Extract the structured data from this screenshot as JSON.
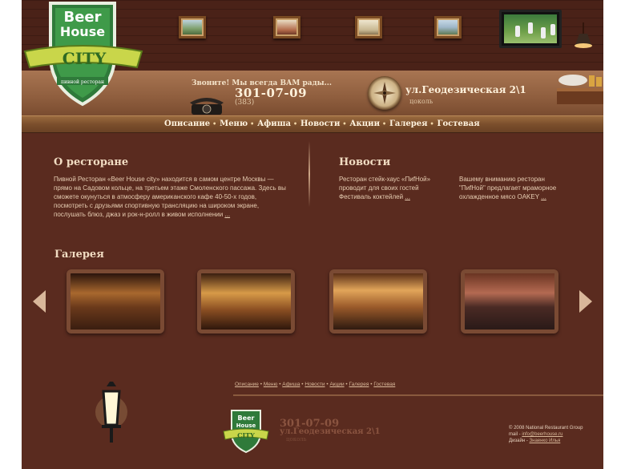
{
  "header": {
    "logo": {
      "line1": "Beer",
      "line2": "House",
      "ribbon": "CITY",
      "caption": "пивной ресторан"
    },
    "call_text": "Звоните! Мы всегда ВАМ рады...",
    "phone": "301-07-09",
    "phone_code": "(383)",
    "address": "ул.Геодезическая 2\\1",
    "level": "цоколь"
  },
  "nav": {
    "items": [
      "Описание",
      "Меню",
      "Афиша",
      "Новости",
      "Акции",
      "Галерея",
      "Гостевая"
    ]
  },
  "about": {
    "title": "О ресторане",
    "text": "Пивной Ресторан «Beer House city» находится в самом центре Москвы — прямо на Садовом кольце, на третьем этаже Смоленского пассажа. Здесь вы сможете окунуться в атмосферу американского кафе 40-50-х годов, посмотреть с друзьями спортивную трансляцию на широком экране, послушать блюз, джаз и рок-н-ролл в живом исполнении",
    "more": "..."
  },
  "news": {
    "title": "Новости",
    "items": [
      {
        "text": "Ресторан стейк-хаус «ПиfНой» проводит для своих гостей Фестиваль коктейлей",
        "more": "..."
      },
      {
        "text": "Вашему вниманию ресторан \"ПиfНой\" предлагает мраморное охлажденное мясо OAKEY",
        "more": "..."
      }
    ]
  },
  "gallery": {
    "title": "Галерея",
    "photos": [
      "gallery-photo-1",
      "gallery-photo-2",
      "gallery-photo-3",
      "gallery-photo-4"
    ]
  },
  "footer": {
    "links": [
      "Описание",
      "Меню",
      "Афиша",
      "Новости",
      "Акции",
      "Галерея",
      "Гостевая"
    ],
    "phone": "301-07-09",
    "address": "ул.Геодезическая 2\\1",
    "level": "цоколь",
    "copyright": "© 2008 National Restaurant Group",
    "mail_label": "mail - ",
    "mail": "info@beerhouse.ru",
    "design_label": "Дизайн - ",
    "designer": "Знаенко Илья"
  },
  "colors": {
    "background": "#5a2b1f",
    "nav": "#7b4f2c",
    "accent_text": "#f1dcc2"
  }
}
